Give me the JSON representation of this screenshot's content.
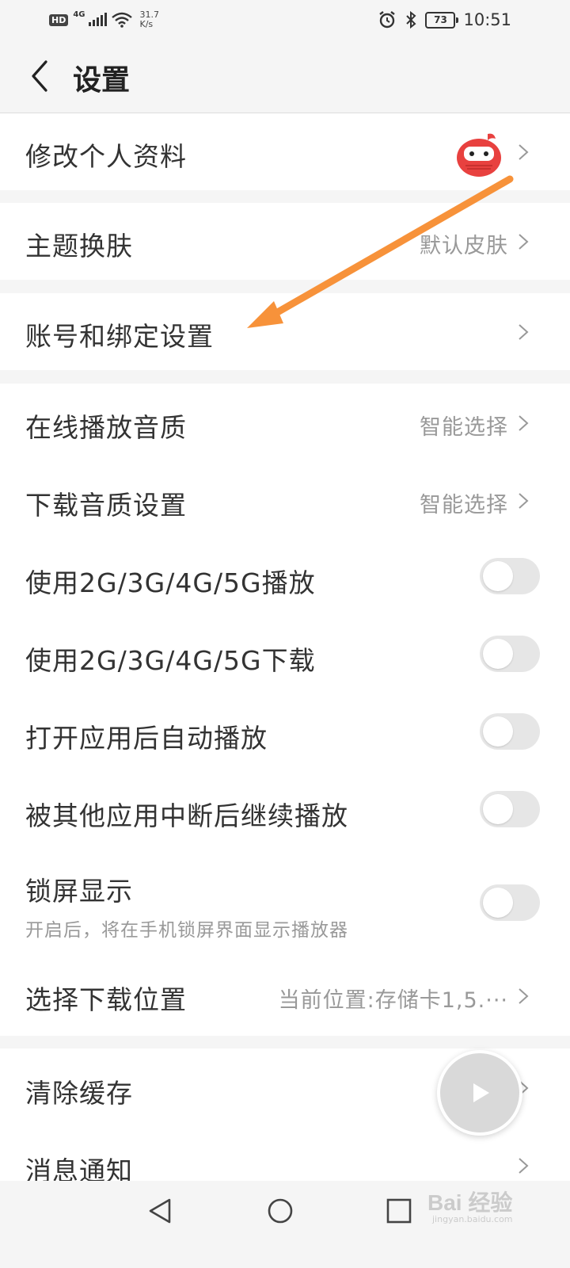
{
  "status_bar": {
    "hd": "HD",
    "network": "4G",
    "speed_value": "31.7",
    "speed_unit": "K/s",
    "battery": "73",
    "time": "10:51"
  },
  "header": {
    "title": "设置"
  },
  "rows": {
    "profile": {
      "label": "修改个人资料"
    },
    "theme": {
      "label": "主题换肤",
      "value": "默认皮肤"
    },
    "account": {
      "label": "账号和绑定设置"
    },
    "online_quality": {
      "label": "在线播放音质",
      "value": "智能选择"
    },
    "download_quality": {
      "label": "下载音质设置",
      "value": "智能选择"
    },
    "mobile_play": {
      "label": "使用2G/3G/4G/5G播放",
      "enabled": false
    },
    "mobile_download": {
      "label": "使用2G/3G/4G/5G下载",
      "enabled": false
    },
    "autoplay": {
      "label": "打开应用后自动播放",
      "enabled": false
    },
    "resume": {
      "label": "被其他应用中断后继续播放",
      "enabled": false
    },
    "lockscreen": {
      "label": "锁屏显示",
      "sub": "开启后，将在手机锁屏界面显示播放器",
      "enabled": false
    },
    "download_location": {
      "label": "选择下载位置",
      "value": "当前位置:存储卡1,5.···"
    },
    "clear_cache": {
      "label": "清除缓存"
    },
    "notifications": {
      "label": "消息通知"
    }
  },
  "watermark": {
    "text": "Bai 经验",
    "sub": "jingyan.baidu.com"
  },
  "colors": {
    "annotation_arrow": "#f7923a",
    "avatar": "#e8413f",
    "toggle_off": "#e6e6e6"
  },
  "icons": [
    "back-icon",
    "chevron-right-icon",
    "avatar-icon",
    "play-icon",
    "nav-back-icon",
    "nav-home-icon",
    "nav-recents-icon",
    "alarm-icon",
    "bluetooth-icon",
    "wifi-icon",
    "signal-icon"
  ]
}
